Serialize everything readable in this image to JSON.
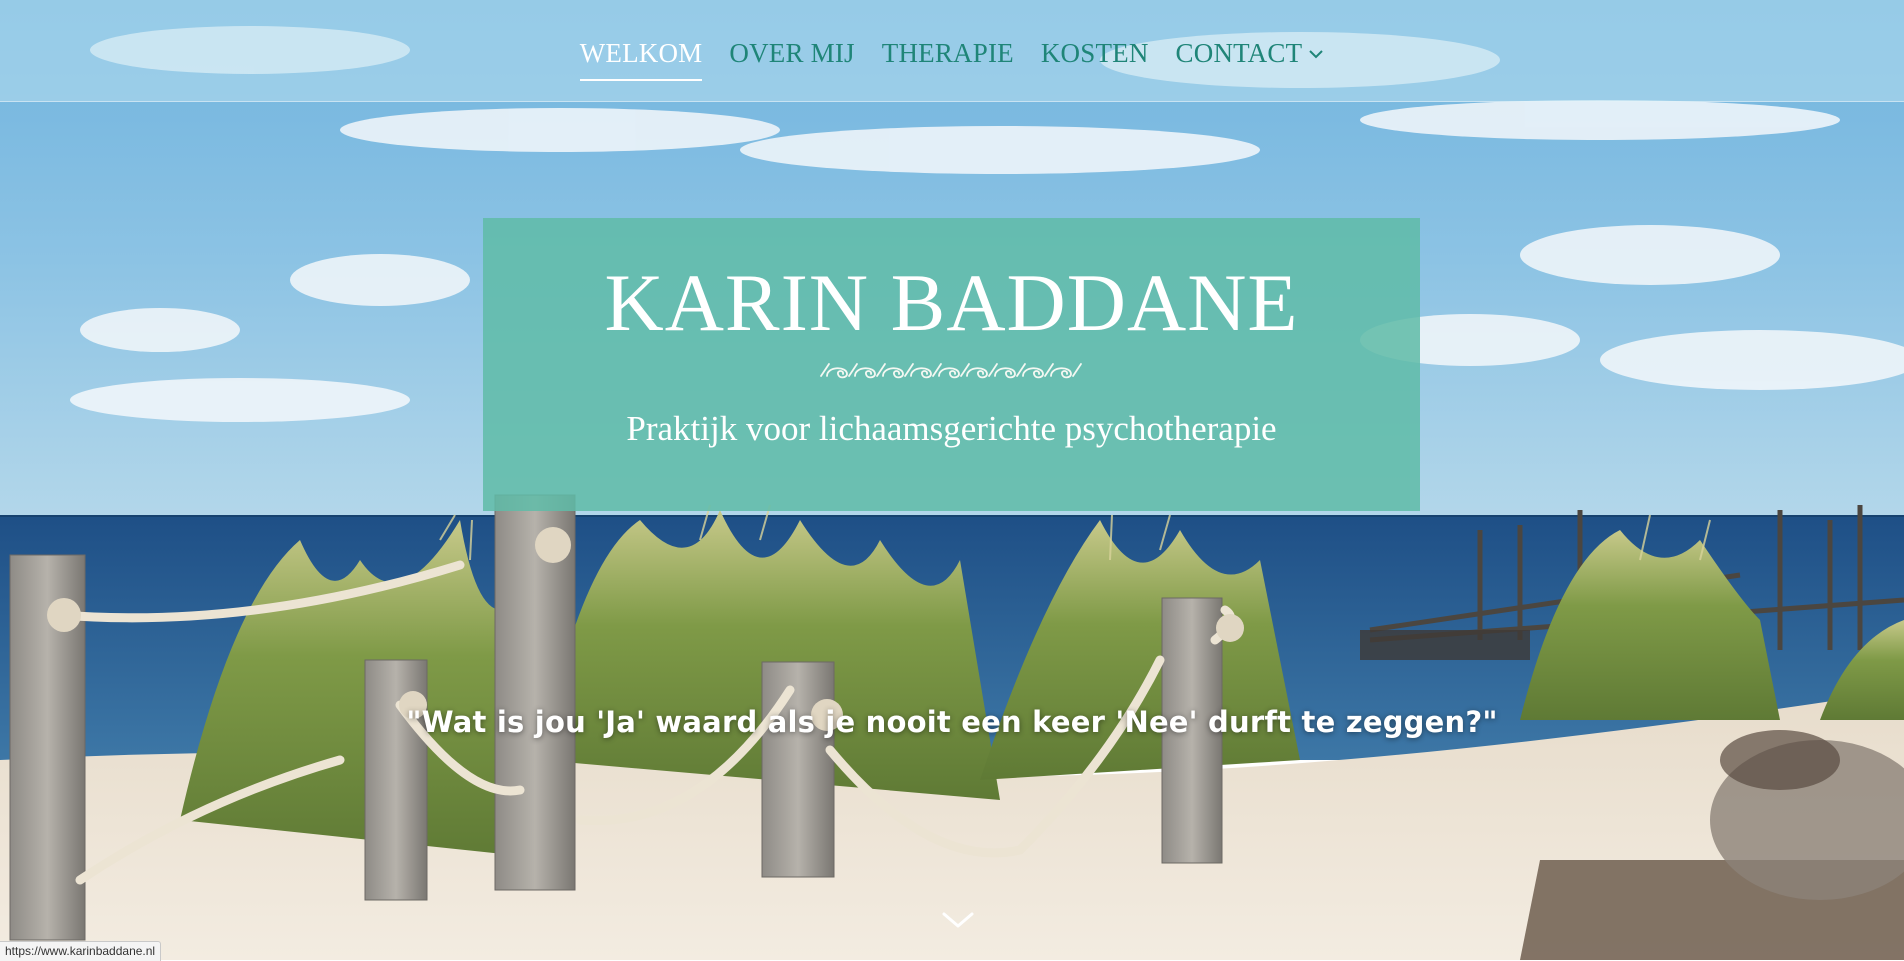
{
  "colors": {
    "nav_text": "#1f8578",
    "nav_active": "#ffffff",
    "title_box": "#60bca8",
    "text_on_dark": "#ffffff"
  },
  "nav": {
    "items": [
      {
        "label": "WELKOM",
        "active": true
      },
      {
        "label": "OVER MIJ",
        "active": false
      },
      {
        "label": "THERAPIE",
        "active": false
      },
      {
        "label": "KOSTEN",
        "active": false
      },
      {
        "label": "CONTACT",
        "active": false,
        "has_dropdown": true,
        "icon": "chevron-down-icon"
      }
    ]
  },
  "hero": {
    "title": "KARIN BADDANE",
    "ornament_icon": "wave-ornament-icon",
    "tagline": "Praktijk voor lichaamsgerichte psychotherapie",
    "quote": "\"Wat is jou 'Ja' waard als je nooit een keer 'Nee' durft te zeggen?\"",
    "scroll_icon": "chevron-down-icon",
    "background_image": "beach-dunes-rope-fence-scene"
  },
  "statusbar": {
    "url": "https://www.karinbaddane.nl"
  }
}
